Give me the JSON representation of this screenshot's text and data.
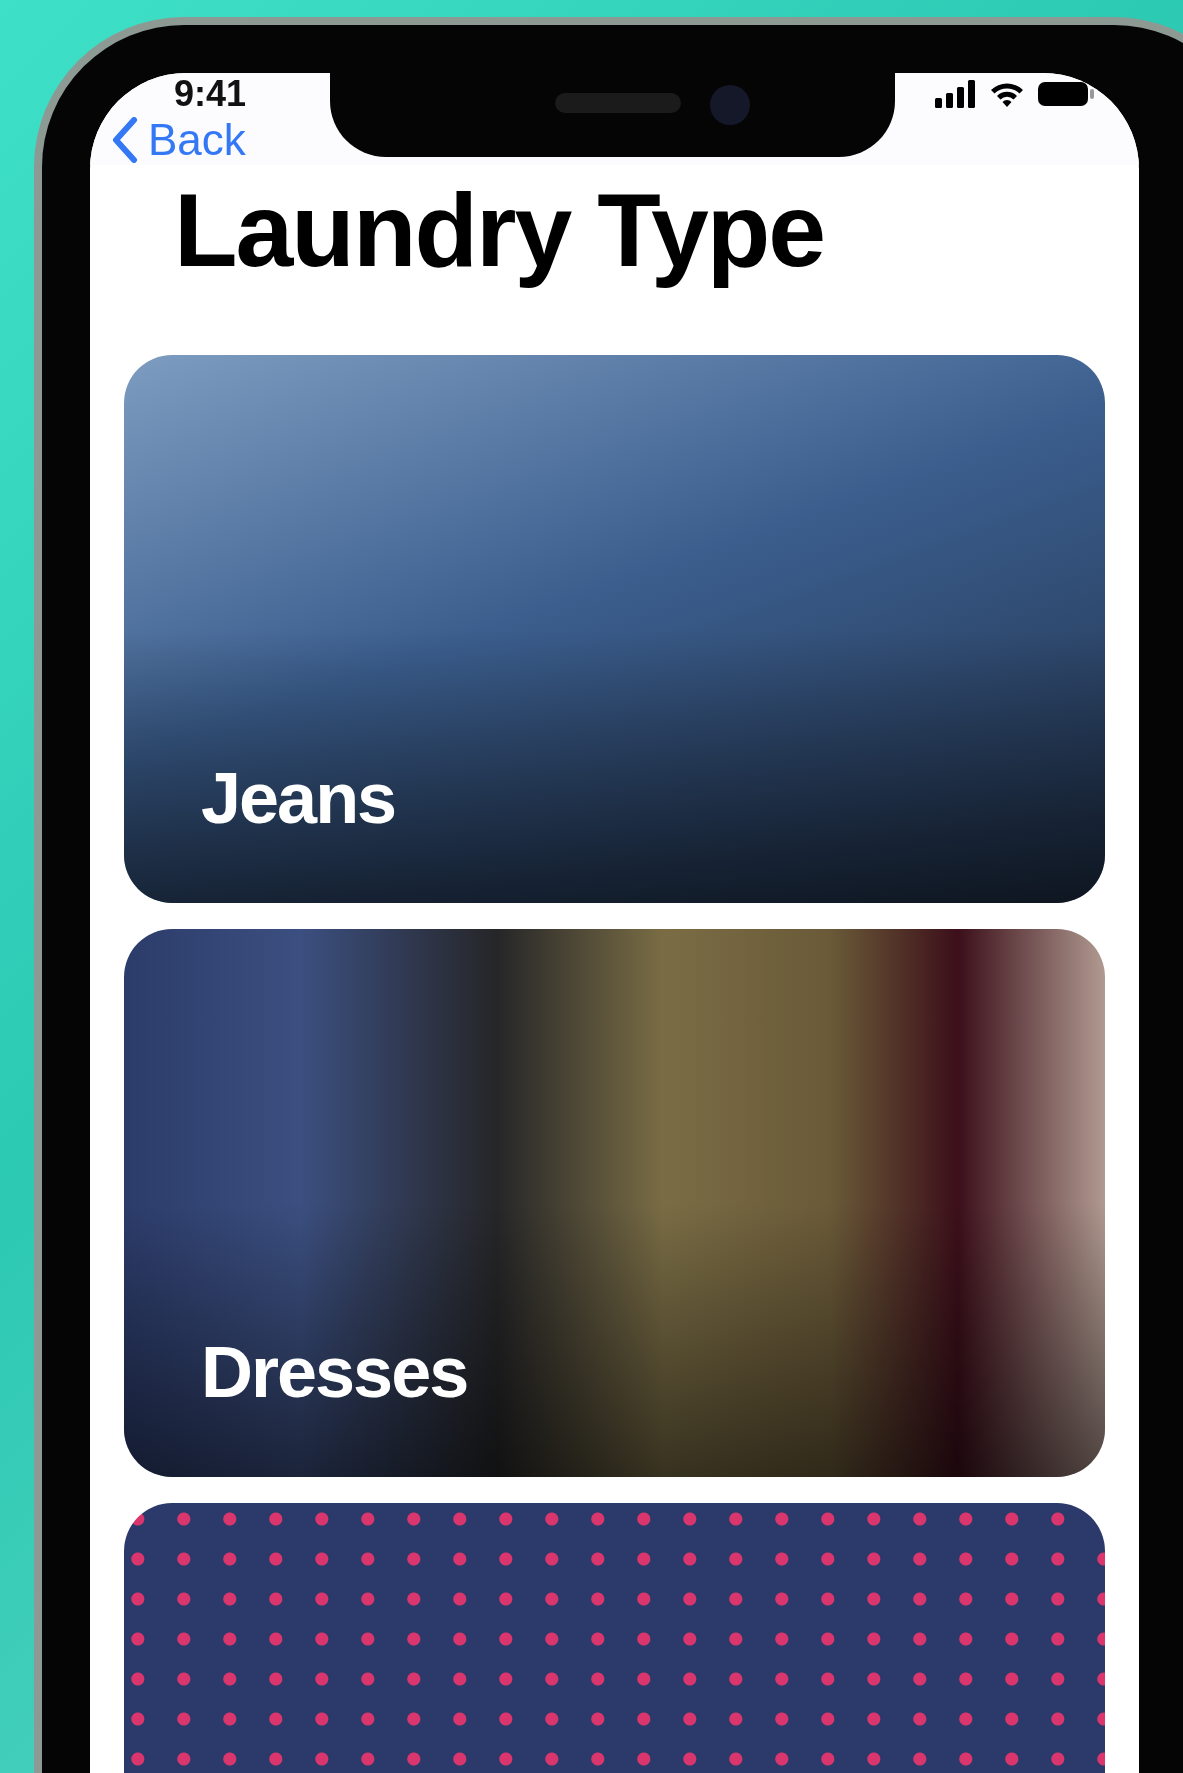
{
  "status_bar": {
    "time": "9:41"
  },
  "nav": {
    "back_label": "Back"
  },
  "title": "Laundry Type",
  "categories": [
    {
      "label": "Jeans",
      "kind": "denim"
    },
    {
      "label": "Dresses",
      "kind": "dress"
    },
    {
      "kind": "floral"
    }
  ]
}
